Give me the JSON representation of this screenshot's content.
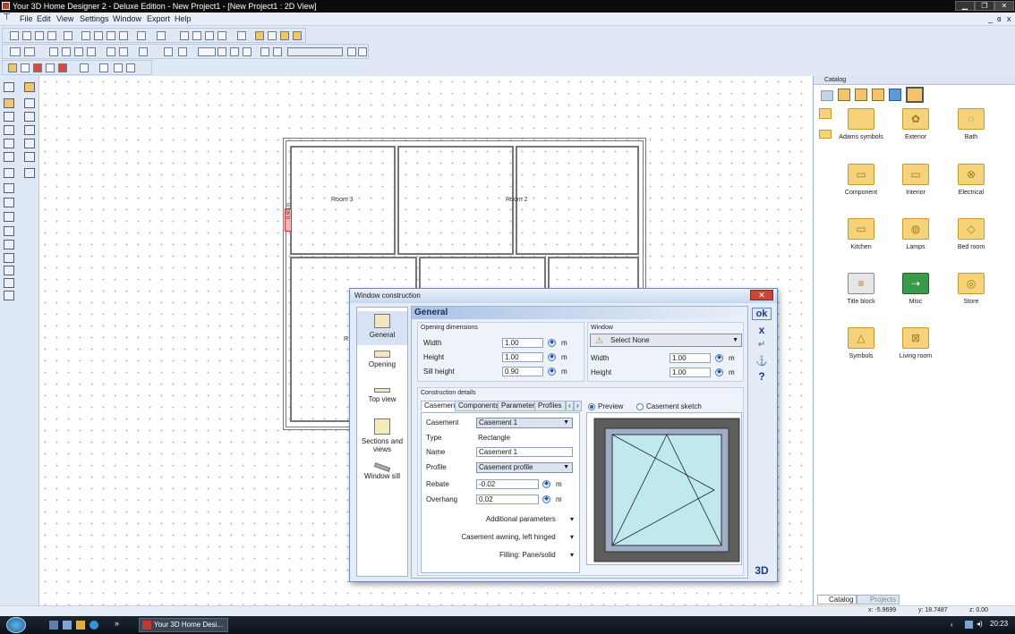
{
  "window": {
    "title": "Your 3D Home Designer 2 - Deluxe Edition - New Project1 - [New Project1 : 2D View]",
    "minimize": "▁",
    "restore": "❐",
    "close": "✕",
    "mdi_min": "_",
    "mdi_restore": "ɞ",
    "mdi_close": "x"
  },
  "menu": [
    "File",
    "Edit",
    "View",
    "Settings",
    "Window",
    "Export",
    "Help"
  ],
  "plan": {
    "rooms": [
      "Room 3",
      "Room 2",
      "R"
    ],
    "dimension": "0.90 m"
  },
  "catalog": {
    "title": "Catalog",
    "items": [
      "Adams symbols",
      "Exterior",
      "Bath",
      "Component",
      "Interior",
      "Electrical",
      "Kitchen",
      "Lamps",
      "Bed room",
      "Title block",
      "Misc",
      "Store",
      "Symbols",
      "Living room"
    ],
    "tabs": [
      "Catalog",
      "Projects"
    ]
  },
  "status": {
    "x": "x: -5.9699",
    "y": "y: 18.7487",
    "z": "z: 0.00"
  },
  "taskbar": {
    "app": "Your 3D Home Desi...",
    "time": "20:23",
    "chevron": "»"
  },
  "dialog": {
    "title": "Window construction",
    "section": "General",
    "sidebar": [
      "General",
      "Opening",
      "Top view",
      "Sections and views",
      "Window sill"
    ],
    "opening": {
      "label": "Opening dimensions",
      "width_label": "Width",
      "width": "1.00",
      "height_label": "Height",
      "height": "1.00",
      "sill_label": "Sill height",
      "sill": "0.90",
      "unit": "m"
    },
    "window": {
      "label": "Window",
      "select": "Select None",
      "width_label": "Width",
      "width": "1.00",
      "height_label": "Height",
      "height": "1.00",
      "unit": "m"
    },
    "construction": {
      "label": "Construction details",
      "tabs": [
        "Casement",
        "Components",
        "Parameter",
        "Profiles"
      ],
      "casement_label": "Casement",
      "casement": "Casement 1",
      "type_label": "Type",
      "type": "Rectangle",
      "name_label": "Name",
      "name": "Casement 1",
      "profile_label": "Profile",
      "profile": "Casement profile",
      "rebate_label": "Rebate",
      "rebate": "-0.02",
      "overhang_label": "Overhang",
      "overhang": "0.02",
      "unit": "m",
      "additional": "Additional parameters",
      "awning": "Casement awning, left hinged",
      "filling": "Filling: Pane/solid"
    },
    "preview": {
      "preview_label": "Preview",
      "sketch_label": "Casement sketch",
      "view3d": "3D"
    },
    "buttons": {
      "ok": "ok",
      "cancel": "x",
      "back": "↵",
      "anchor": "⚓",
      "help": "?"
    }
  },
  "colors": {
    "accent": "#1b2f55",
    "taskbar": "#0b1117",
    "folder": "#f5d37a"
  }
}
